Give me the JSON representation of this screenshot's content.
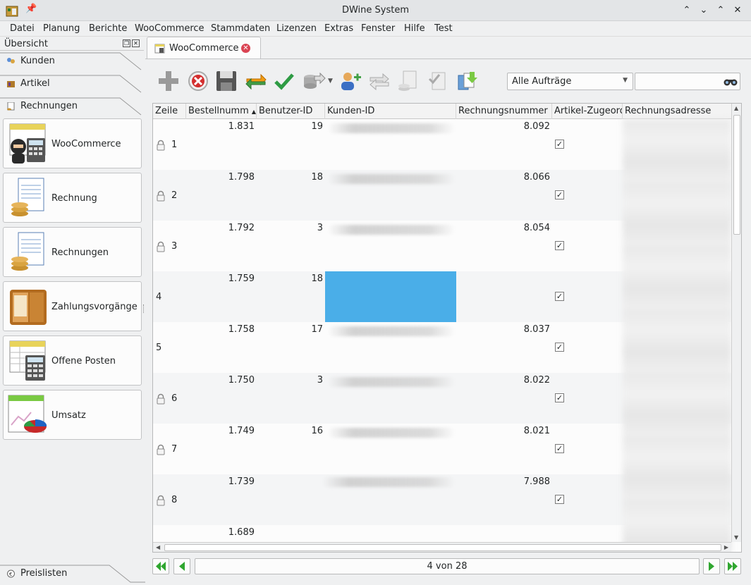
{
  "window": {
    "title": "DWine System"
  },
  "menu": [
    "Datei",
    "Planung",
    "Berichte",
    "WooCommerce",
    "Stammdaten",
    "Lizenzen",
    "Extras",
    "Fenster",
    "Hilfe",
    "Test"
  ],
  "left_panel": {
    "header": "Übersicht",
    "sections_top": [
      "Kunden",
      "Artikel",
      "Rechnungen"
    ],
    "nav_items": [
      "WooCommerce",
      "Rechnung",
      "Rechnungen",
      "Zahlungsvorgänge",
      "Offene Posten",
      "Umsatz"
    ],
    "section_bottom": "Preislisten"
  },
  "tab": {
    "label": "WooCommerce"
  },
  "filter": {
    "selected": "Alle Aufträge",
    "search_value": ""
  },
  "grid": {
    "columns": [
      "Zeile",
      "Bestellnumm",
      "Benutzer-ID",
      "Kunden-ID",
      "Rechnungsnummer",
      "Artikel-Zugeord",
      "Rechnungsadresse"
    ],
    "rows": [
      {
        "zeile": "1",
        "bestell": "1.831",
        "benutzer": "19",
        "rechnung": "8.092",
        "checked": true,
        "locked": true
      },
      {
        "zeile": "2",
        "bestell": "1.798",
        "benutzer": "18",
        "rechnung": "8.066",
        "checked": true,
        "locked": true
      },
      {
        "zeile": "3",
        "bestell": "1.792",
        "benutzer": "3",
        "rechnung": "8.054",
        "checked": true,
        "locked": true
      },
      {
        "zeile": "4",
        "bestell": "1.759",
        "benutzer": "18",
        "rechnung": "",
        "checked": true,
        "locked": false,
        "selected": true
      },
      {
        "zeile": "5",
        "bestell": "1.758",
        "benutzer": "17",
        "rechnung": "8.037",
        "checked": true,
        "locked": false
      },
      {
        "zeile": "6",
        "bestell": "1.750",
        "benutzer": "3",
        "rechnung": "8.022",
        "checked": true,
        "locked": true
      },
      {
        "zeile": "7",
        "bestell": "1.749",
        "benutzer": "16",
        "rechnung": "8.021",
        "checked": true,
        "locked": true
      },
      {
        "zeile": "8",
        "bestell": "1.739",
        "benutzer": "",
        "rechnung": "7.988",
        "checked": true,
        "locked": true
      },
      {
        "zeile": "",
        "bestell": "1.689",
        "benutzer": "",
        "rechnung": "",
        "checked": false,
        "locked": false
      }
    ]
  },
  "pager": {
    "text": "4 von 28"
  },
  "colors": {
    "selection": "#4aaee8",
    "close": "#da4453",
    "nav_green": "#2fa62f"
  }
}
